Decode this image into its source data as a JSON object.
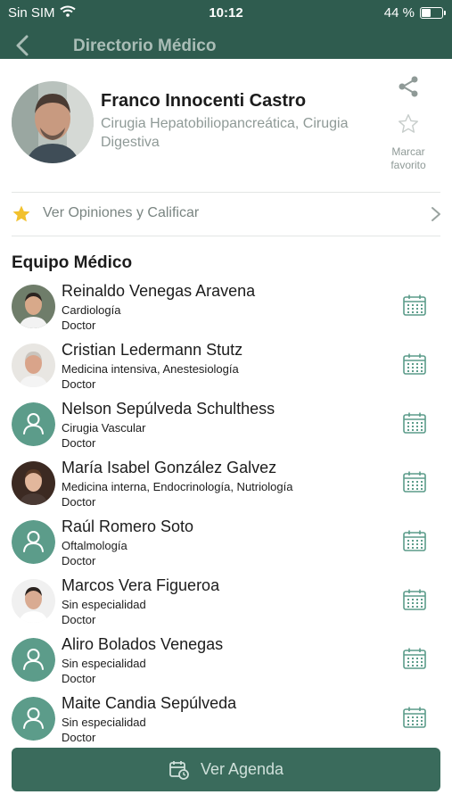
{
  "status_bar": {
    "carrier": "Sin SIM",
    "time": "10:12",
    "battery_text": "44 %",
    "battery_level": 0.44
  },
  "nav": {
    "title": "Directorio Médico",
    "back_icon": "chevron-left-icon"
  },
  "profile": {
    "name": "Franco Innocenti Castro",
    "specialty": "Cirugia Hepatobiliopancreática, Cirugia Digestiva",
    "share_icon": "share-icon",
    "favorite_icon": "star-outline-icon",
    "favorite_label": "Marcar favorito"
  },
  "opinions": {
    "label": "Ver Opiniones y Calificar",
    "icon": "star-icon"
  },
  "team": {
    "title": "Equipo Médico",
    "members": [
      {
        "name": "Reinaldo Venegas Aravena",
        "specialty": "Cardiología",
        "role": "Doctor",
        "avatar": "photo"
      },
      {
        "name": "Cristian Ledermann Stutz",
        "specialty": "Medicina intensiva, Anestesiología",
        "role": "Doctor",
        "avatar": "photo"
      },
      {
        "name": "Nelson Sepúlveda Schulthess",
        "specialty": "Cirugia Vascular",
        "role": "Doctor",
        "avatar": "placeholder"
      },
      {
        "name": "María Isabel González Galvez",
        "specialty": "Medicina interna, Endocrinología, Nutriología",
        "role": "Doctor",
        "avatar": "photo"
      },
      {
        "name": "Raúl Romero Soto",
        "specialty": "Oftalmología",
        "role": "Doctor",
        "avatar": "placeholder"
      },
      {
        "name": "Marcos Vera Figueroa",
        "specialty": "Sin especialidad",
        "role": "Doctor",
        "avatar": "photo"
      },
      {
        "name": "Aliro Bolados Venegas",
        "specialty": "Sin especialidad",
        "role": "Doctor",
        "avatar": "placeholder"
      },
      {
        "name": "Maite Candia Sepúlveda",
        "specialty": "Sin especialidad",
        "role": "Doctor",
        "avatar": "placeholder"
      }
    ]
  },
  "footer": {
    "agenda_label": "Ver Agenda",
    "agenda_icon": "calendar-clock-icon"
  },
  "colors": {
    "header": "#2f5c4f",
    "accent": "#5c9c8a",
    "button": "#3a6b5c",
    "star": "#f2c12e"
  }
}
